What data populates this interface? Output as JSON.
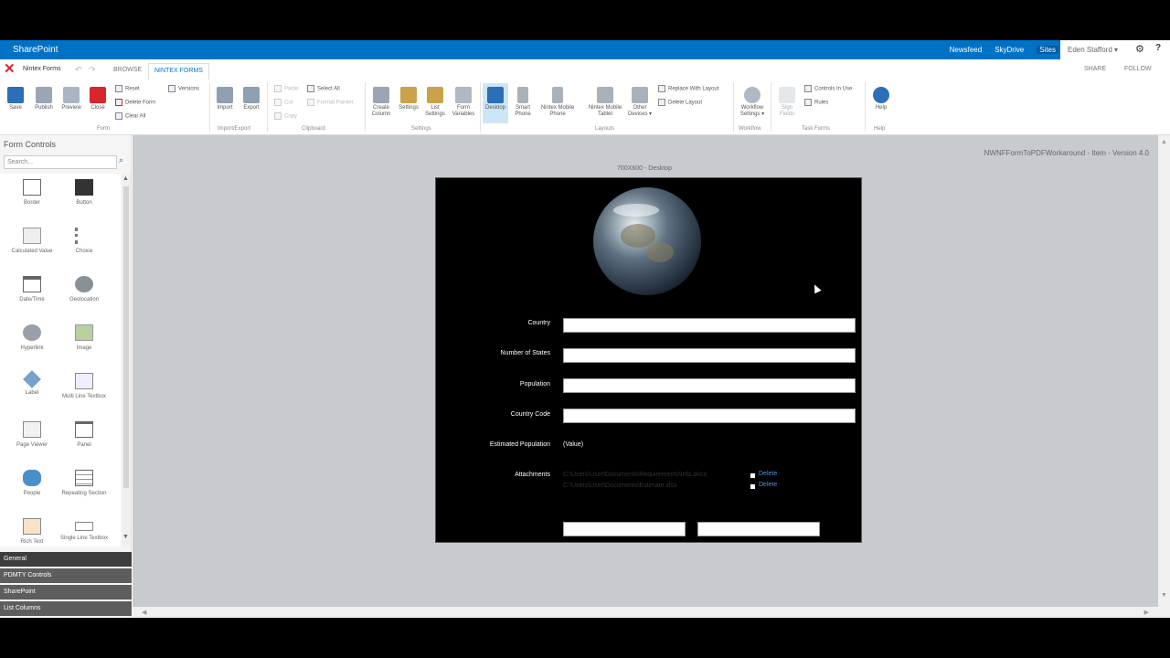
{
  "suitebar": {
    "brand": "SharePoint",
    "links": [
      "Newsfeed",
      "SkyDrive",
      "Sites"
    ],
    "user": "Eden Stafford ▾",
    "gear": "⚙",
    "help": "?"
  },
  "tabrow": {
    "app": "Nintex Forms",
    "tabs": [
      "BROWSE",
      "NINTEX FORMS"
    ],
    "share": "SHARE",
    "follow": "FOLLOW"
  },
  "ribbon": {
    "form": {
      "save": "Save",
      "publish": "Publish",
      "preview": "Preview",
      "close": "Close",
      "reset": "Reset",
      "delete_form": "Delete Form",
      "clear_all": "Clear All",
      "versions": "Versions",
      "group": "Form"
    },
    "import_export": {
      "import": "Import",
      "export": "Export",
      "group": "Import/Export"
    },
    "clipboard": {
      "paste": "Paste",
      "cut": "Cut",
      "copy": "Copy",
      "select_all": "Select All",
      "format_painter": "Format Painter",
      "group": "Clipboard"
    },
    "settings": {
      "create_column": "Create Column",
      "settings": "Settings",
      "list_settings": "List Settings",
      "form_variables": "Form Variables",
      "group": "Settings"
    },
    "layouts": {
      "desktop": "Desktop",
      "smart_phone": "Smart Phone",
      "mobile_phone": "Nintex Mobile Phone",
      "mobile_tablet": "Nintex Mobile Tablet",
      "other_devices": "Other Devices ▾",
      "replace": "Replace With Layout",
      "delete_layout": "Delete Layout",
      "group": "Layouts"
    },
    "workflow": {
      "settings": "Workflow Settings ▾",
      "group": "Workflow"
    },
    "task_forms": {
      "sign": "Sign Fields",
      "controls_in_use": "Controls In Use",
      "rules": "Rules",
      "group": "Task Forms"
    },
    "help": {
      "help": "Help",
      "group": "Help"
    }
  },
  "left": {
    "title": "Form Controls",
    "search_placeholder": "Search...",
    "controls": [
      "Border",
      "Button",
      "Calculated Value",
      "Choice",
      "Date/Time",
      "Geolocation",
      "Hyperlink",
      "Image",
      "Label",
      "Multi Line Textbox",
      "Page Viewer",
      "Panel",
      "People",
      "Repeating Section",
      "Rich Text",
      "Single Line Textbox"
    ],
    "categories": [
      "General",
      "PDMTY Controls",
      "SharePoint",
      "List Columns"
    ]
  },
  "canvas": {
    "version": "NWNFFormToPDFWorkaround - Item - Version 4.0",
    "layout_label": "700X600 - Desktop",
    "fields": [
      "Country",
      "Number of States",
      "Population",
      "Country Code",
      "Estimated Population",
      "Attachments"
    ],
    "estimated_value": "(Value)",
    "attachments": [
      "C:\\Users\\User\\Documents\\Requirements\\Info.docx",
      "C:\\Users\\User\\Documents\\Estimate.xlsx"
    ],
    "delete_label": "Delete"
  }
}
